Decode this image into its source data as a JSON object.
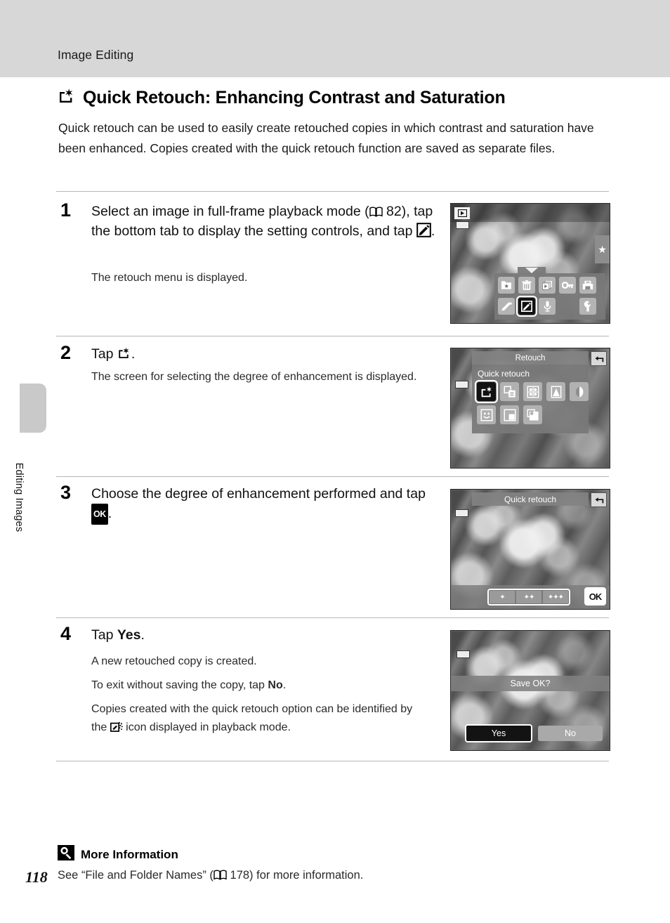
{
  "header": {
    "running_head": "Image Editing"
  },
  "sidebar": {
    "chapter_label": "Editing Images"
  },
  "section": {
    "icon": "quick-retouch-icon",
    "title": "Quick Retouch: Enhancing Contrast and Saturation",
    "intro": "Quick retouch can be used to easily create retouched copies in which contrast and saturation have been enhanced. Copies created with the quick retouch function are saved as separate files."
  },
  "steps": [
    {
      "number": "1",
      "title_a": "Select an image in full-frame playback mode (",
      "title_ref": "82",
      "title_b": "), tap the bottom tab to display the setting controls, and tap ",
      "title_c": ".",
      "body": "The retouch menu is displayed."
    },
    {
      "number": "2",
      "title_a": "Tap ",
      "title_c": ".",
      "body": "The screen for selecting the degree of enhancement is displayed."
    },
    {
      "number": "3",
      "title_a": "Choose the degree of enhancement performed and tap ",
      "ok_chip": "OK",
      "title_c": "."
    },
    {
      "number": "4",
      "title_a": "Tap ",
      "title_bold": "Yes",
      "title_c": ".",
      "body1": "A new retouched copy is created.",
      "body2_a": "To exit without saving the copy, tap ",
      "body2_bold": "No",
      "body2_c": ".",
      "body3_a": "Copies created with the quick retouch option can be identified by the ",
      "body3_b": " icon displayed in playback mode."
    }
  ],
  "screens": {
    "one": {
      "name": "full-frame-playback-with-controls",
      "playback_icon": "playback-mode-icon",
      "battery_icon": "battery-icon",
      "favorites_tab_icon": "star-icon",
      "menu_row1": [
        "star-folder-icon",
        "trash-icon",
        "slideshow-icon",
        "key-protect-icon",
        "print-order-icon"
      ],
      "menu_row2": [
        "pencil-draw-icon",
        "retouch-icon",
        "voice-memo-icon",
        "wrench-setup-icon"
      ],
      "selected": "retouch-icon"
    },
    "two": {
      "name": "retouch-menu",
      "title": "Retouch",
      "selected_label": "Quick retouch",
      "back_icon": "back-arrow-icon",
      "row1": [
        "quick-retouch-icon",
        "d-lighting-icon",
        "skin-softening-icon",
        "filter-effects-icon",
        "soft-filter-icon"
      ],
      "row2": [
        "glamour-retouch-icon",
        "small-picture-icon",
        "crop-icon"
      ],
      "selected": "quick-retouch-icon"
    },
    "three": {
      "name": "quick-retouch-level",
      "title": "Quick retouch",
      "back_icon": "back-arrow-icon",
      "levels": [
        "✦",
        "✦✦",
        "✦✦✦"
      ],
      "ok_label": "OK"
    },
    "four": {
      "name": "save-confirmation-dialog",
      "prompt": "Save OK?",
      "yes_label": "Yes",
      "no_label": "No",
      "selected": "yes-button"
    }
  },
  "note": {
    "icon": "more-information-icon",
    "title": "More Information",
    "body_a": "See “File and Folder Names” (",
    "body_ref": "178",
    "body_b": ") for more information."
  },
  "page_number": "118",
  "colors": {
    "header_band": "#d7d7d7",
    "side_tab": "#c9c9c9",
    "divider": "#b6b6b6",
    "text": "#1a1a1a"
  }
}
